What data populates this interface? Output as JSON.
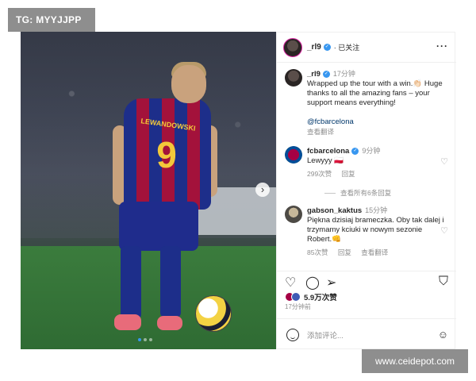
{
  "watermarks": {
    "top": "TG: MYYJJPP",
    "bottom": "www.ceidepot.com"
  },
  "photo": {
    "jersey_name": "LEWANDOWSKI",
    "jersey_number": "9",
    "next_icon": "chevron-right-icon",
    "carousel": {
      "count": 3,
      "active": 1
    }
  },
  "header": {
    "username": "_rl9",
    "verified_icon": "verified-badge-icon",
    "follow_status": "已关注",
    "more": "···"
  },
  "caption": {
    "username": "_rl9",
    "time": "17分钟",
    "text": "Wrapped up the tour with a win.👏🏻 Huge thanks to all the amazing fans – your support means everything!",
    "mention": "@fcbarcelona",
    "translate": "查看翻译"
  },
  "comments": [
    {
      "username": "fcbarcelona",
      "time": "9分钟",
      "text": "Lewyyy 🇵🇱",
      "likes": "299次赞",
      "reply": "回复"
    },
    {
      "username": "gabson_kaktus",
      "time": "15分钟",
      "text": "Piękna dzisiaj brameczka. Oby tak dalej i trzymamy kciuki w nowym sezonie Robert.👊",
      "likes": "85次赞",
      "reply": "回复",
      "translate": "查看翻译"
    }
  ],
  "view_replies": "查看所有6条回复",
  "actions": {
    "like_icon": "heart-icon",
    "comment_icon": "comment-icon",
    "share_icon": "send-icon",
    "save_icon": "bookmark-icon"
  },
  "likes_count": "5.9万次赞",
  "post_time": "17分钟前",
  "comment_box": {
    "placeholder": "添加评论...",
    "emoji_icon": "smile-icon"
  },
  "colors": {
    "verified": "#3897f0",
    "barca_blue": "#1d2e8a",
    "barca_red": "#a3123b",
    "number_yellow": "#f3c83a"
  }
}
